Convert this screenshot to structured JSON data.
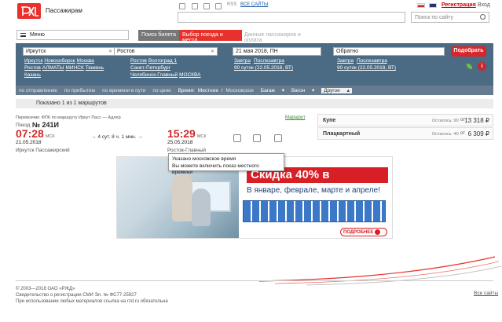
{
  "header": {
    "brand": "Пассажирам",
    "rss": "RSS",
    "all_sites": "ВСЕ САЙТЫ",
    "register": "Регистрация",
    "login": "Вход",
    "site_search_placeholder": "Поиск по сайту"
  },
  "menu": {
    "label": "Меню"
  },
  "steps": [
    "Поиск билета",
    "Выбор поезда и места",
    "Данные пассажиров и оплата"
  ],
  "search": {
    "from": "Иркутск",
    "to": "Ростов",
    "date_there": "21 мая 2018, ПН",
    "date_back": "Обратно",
    "from_suggestions": [
      "Иркутск",
      "Новосибирск",
      "Москва",
      "Ростов",
      "АЛМАТЫ",
      "МИНСК",
      "Тюмень",
      "Казань"
    ],
    "to_suggestions": [
      "Ростов",
      "Волгоград 1",
      "Санкт-Петербург",
      "Челябинск-Главный",
      "МОСКВА"
    ],
    "date_there_links": [
      "Завтра",
      "Послезавтра",
      "90 суток (22.05.2018, ВТ)"
    ],
    "date_back_links": [
      "Завтра",
      "Послезавтра",
      "90 суток (22.05.2018, ВТ)"
    ],
    "find_button": "Подобрать"
  },
  "filters": {
    "by_departure": "по отправлению",
    "by_arrival": "по прибытию",
    "by_travel_time": "по времени в пути",
    "by_price": "по цене",
    "time_label": "Время:",
    "time_local": "Местное",
    "time_sep": "/",
    "time_moscow": "Московское",
    "luggage": "Багаж",
    "car": "Вагон",
    "other": "Другое"
  },
  "results": {
    "shown": "Показано 1 из 1 маршрутов"
  },
  "train": {
    "carrier": "Перевозчик: ФПК   по маршруту Иркут Пасс — Адлер",
    "number_label": "Поезд",
    "number": "№ 241И",
    "route_link": "Маршрут",
    "dep_time": "07:28",
    "dep_tz": "МСК",
    "dep_date": "21.05.2018",
    "dep_station": "Иркутск Пассажирский",
    "duration": "4 сут. 8 ч. 1 мин.",
    "arr_time": "15:29",
    "arr_tz": "МСК",
    "arr_date": "25.05.2018",
    "arr_station": "Ростов-Главный"
  },
  "seats": [
    {
      "name": "Купе",
      "available": "Осталось: 90",
      "from": "от",
      "price": "13 318 ₽"
    },
    {
      "name": "Плацкартный",
      "available": "Осталось: 40",
      "from": "от",
      "price": "6 309 ₽"
    }
  ],
  "tooltip": {
    "line1": "Указано московское время",
    "line2": "Вы можете включить показ местного времени"
  },
  "ad": {
    "title": "Скидка 40% в плацкарте!",
    "subtitle": "В январе, феврале, марте и апреле!",
    "more": "ПОДРОБНЕЕ"
  },
  "footer": {
    "copyright": "© 2003—2018 ОАО «РЖД»",
    "registration": "Свидетельство о регистрации СМИ Эл. № ФС77-25927",
    "notice": "При использовании любых материалов ссылка на rzd.ru обязательна",
    "all_sites": "Все сайты"
  },
  "colors": {
    "brand_red": "#e8312c",
    "panel": "#4b6b84",
    "link": "#1a5aa0"
  }
}
